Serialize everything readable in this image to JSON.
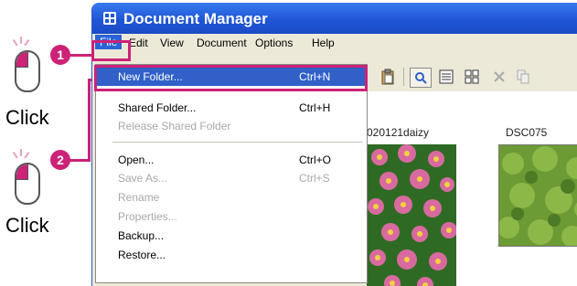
{
  "window": {
    "title": "Document Manager"
  },
  "menubar": {
    "items": [
      "File",
      "Edit",
      "View",
      "Document",
      "Options",
      "Help"
    ]
  },
  "instructions": {
    "click_label_1": "Click",
    "click_label_2": "Click",
    "step_1": "1",
    "step_2": "2"
  },
  "file_menu": {
    "items": [
      {
        "label": "New Folder...",
        "shortcut": "Ctrl+N",
        "state": "selected"
      },
      {
        "label": "Shared Folder...",
        "shortcut": "Ctrl+H",
        "state": "enabled"
      },
      {
        "label": "Release Shared Folder",
        "shortcut": "",
        "state": "disabled"
      },
      {
        "label": "Open...",
        "shortcut": "Ctrl+O",
        "state": "enabled"
      },
      {
        "label": "Save As...",
        "shortcut": "Ctrl+S",
        "state": "disabled"
      },
      {
        "label": "Rename",
        "shortcut": "",
        "state": "disabled"
      },
      {
        "label": "Properties...",
        "shortcut": "",
        "state": "disabled"
      },
      {
        "label": "Backup...",
        "shortcut": "",
        "state": "enabled"
      },
      {
        "label": "Restore...",
        "shortcut": "",
        "state": "enabled"
      }
    ]
  },
  "toolbar": {
    "icons": [
      "paste-icon",
      "preview-icon",
      "details-view-icon",
      "thumbnail-view-icon",
      "delete-icon",
      "copy-icon"
    ]
  },
  "thumbnails": [
    {
      "name": "020121daizy"
    },
    {
      "name": "DSC075"
    }
  ],
  "colors": {
    "accent": "#cc2277",
    "titlebar": "#1f56d6",
    "selection": "#3060c8"
  }
}
